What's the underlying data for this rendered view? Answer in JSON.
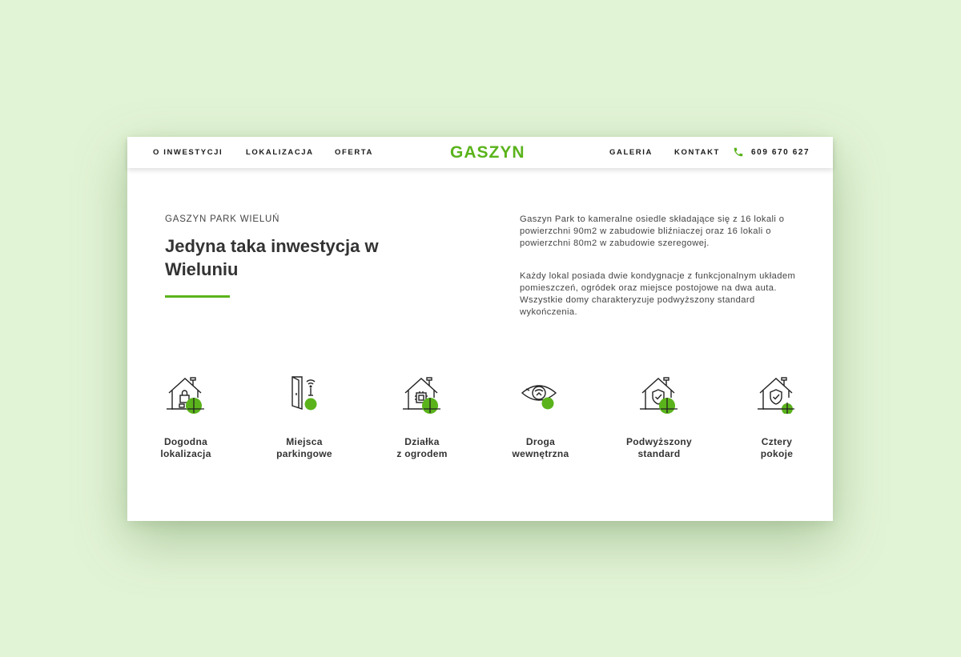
{
  "nav": {
    "left_links": [
      "O INWESTYCJI",
      "LOKALIZACJA",
      "OFERTA"
    ],
    "logo": "GASZYN",
    "right_links": [
      "GALERIA",
      "KONTAKT"
    ],
    "phone": "609 670 627"
  },
  "hero": {
    "eyebrow": "GASZYN PARK WIELUŃ",
    "title": "Jedyna taka inwestycja w Wieluniu",
    "paragraphs": [
      "Gaszyn Park to kameralne osiedle składające się z 16 lokali o powierzchni 90m2 w zabudowie bliźniaczej oraz 16 lokali o powierzchni 80m2 w zabudowie szeregowej.",
      "Każdy lokal posiada dwie kondygnacje z funkcjonalnym układem pomieszczeń, ogródek oraz miejsce postojowe na dwa auta. Wszystkie domy charakteryzuje podwyższony standard wykończenia."
    ]
  },
  "features": [
    {
      "label": "Dogodna\nlokalizacja",
      "icon": "smart-home-lock-icon"
    },
    {
      "label": "Miejsca\nparkingowe",
      "icon": "door-wifi-icon"
    },
    {
      "label": "Działka\nz ogrodem",
      "icon": "smart-home-chip-icon"
    },
    {
      "label": "Droga\nwewnętrzna",
      "icon": "eye-icon"
    },
    {
      "label": "Podwyższony\nstandard",
      "icon": "house-shield-icon"
    },
    {
      "label": "Cztery\npokoje",
      "icon": "house-shield-small-icon"
    }
  ],
  "colors": {
    "accent": "#5ab31b",
    "background": "#e2f4d6",
    "text": "#333333"
  }
}
